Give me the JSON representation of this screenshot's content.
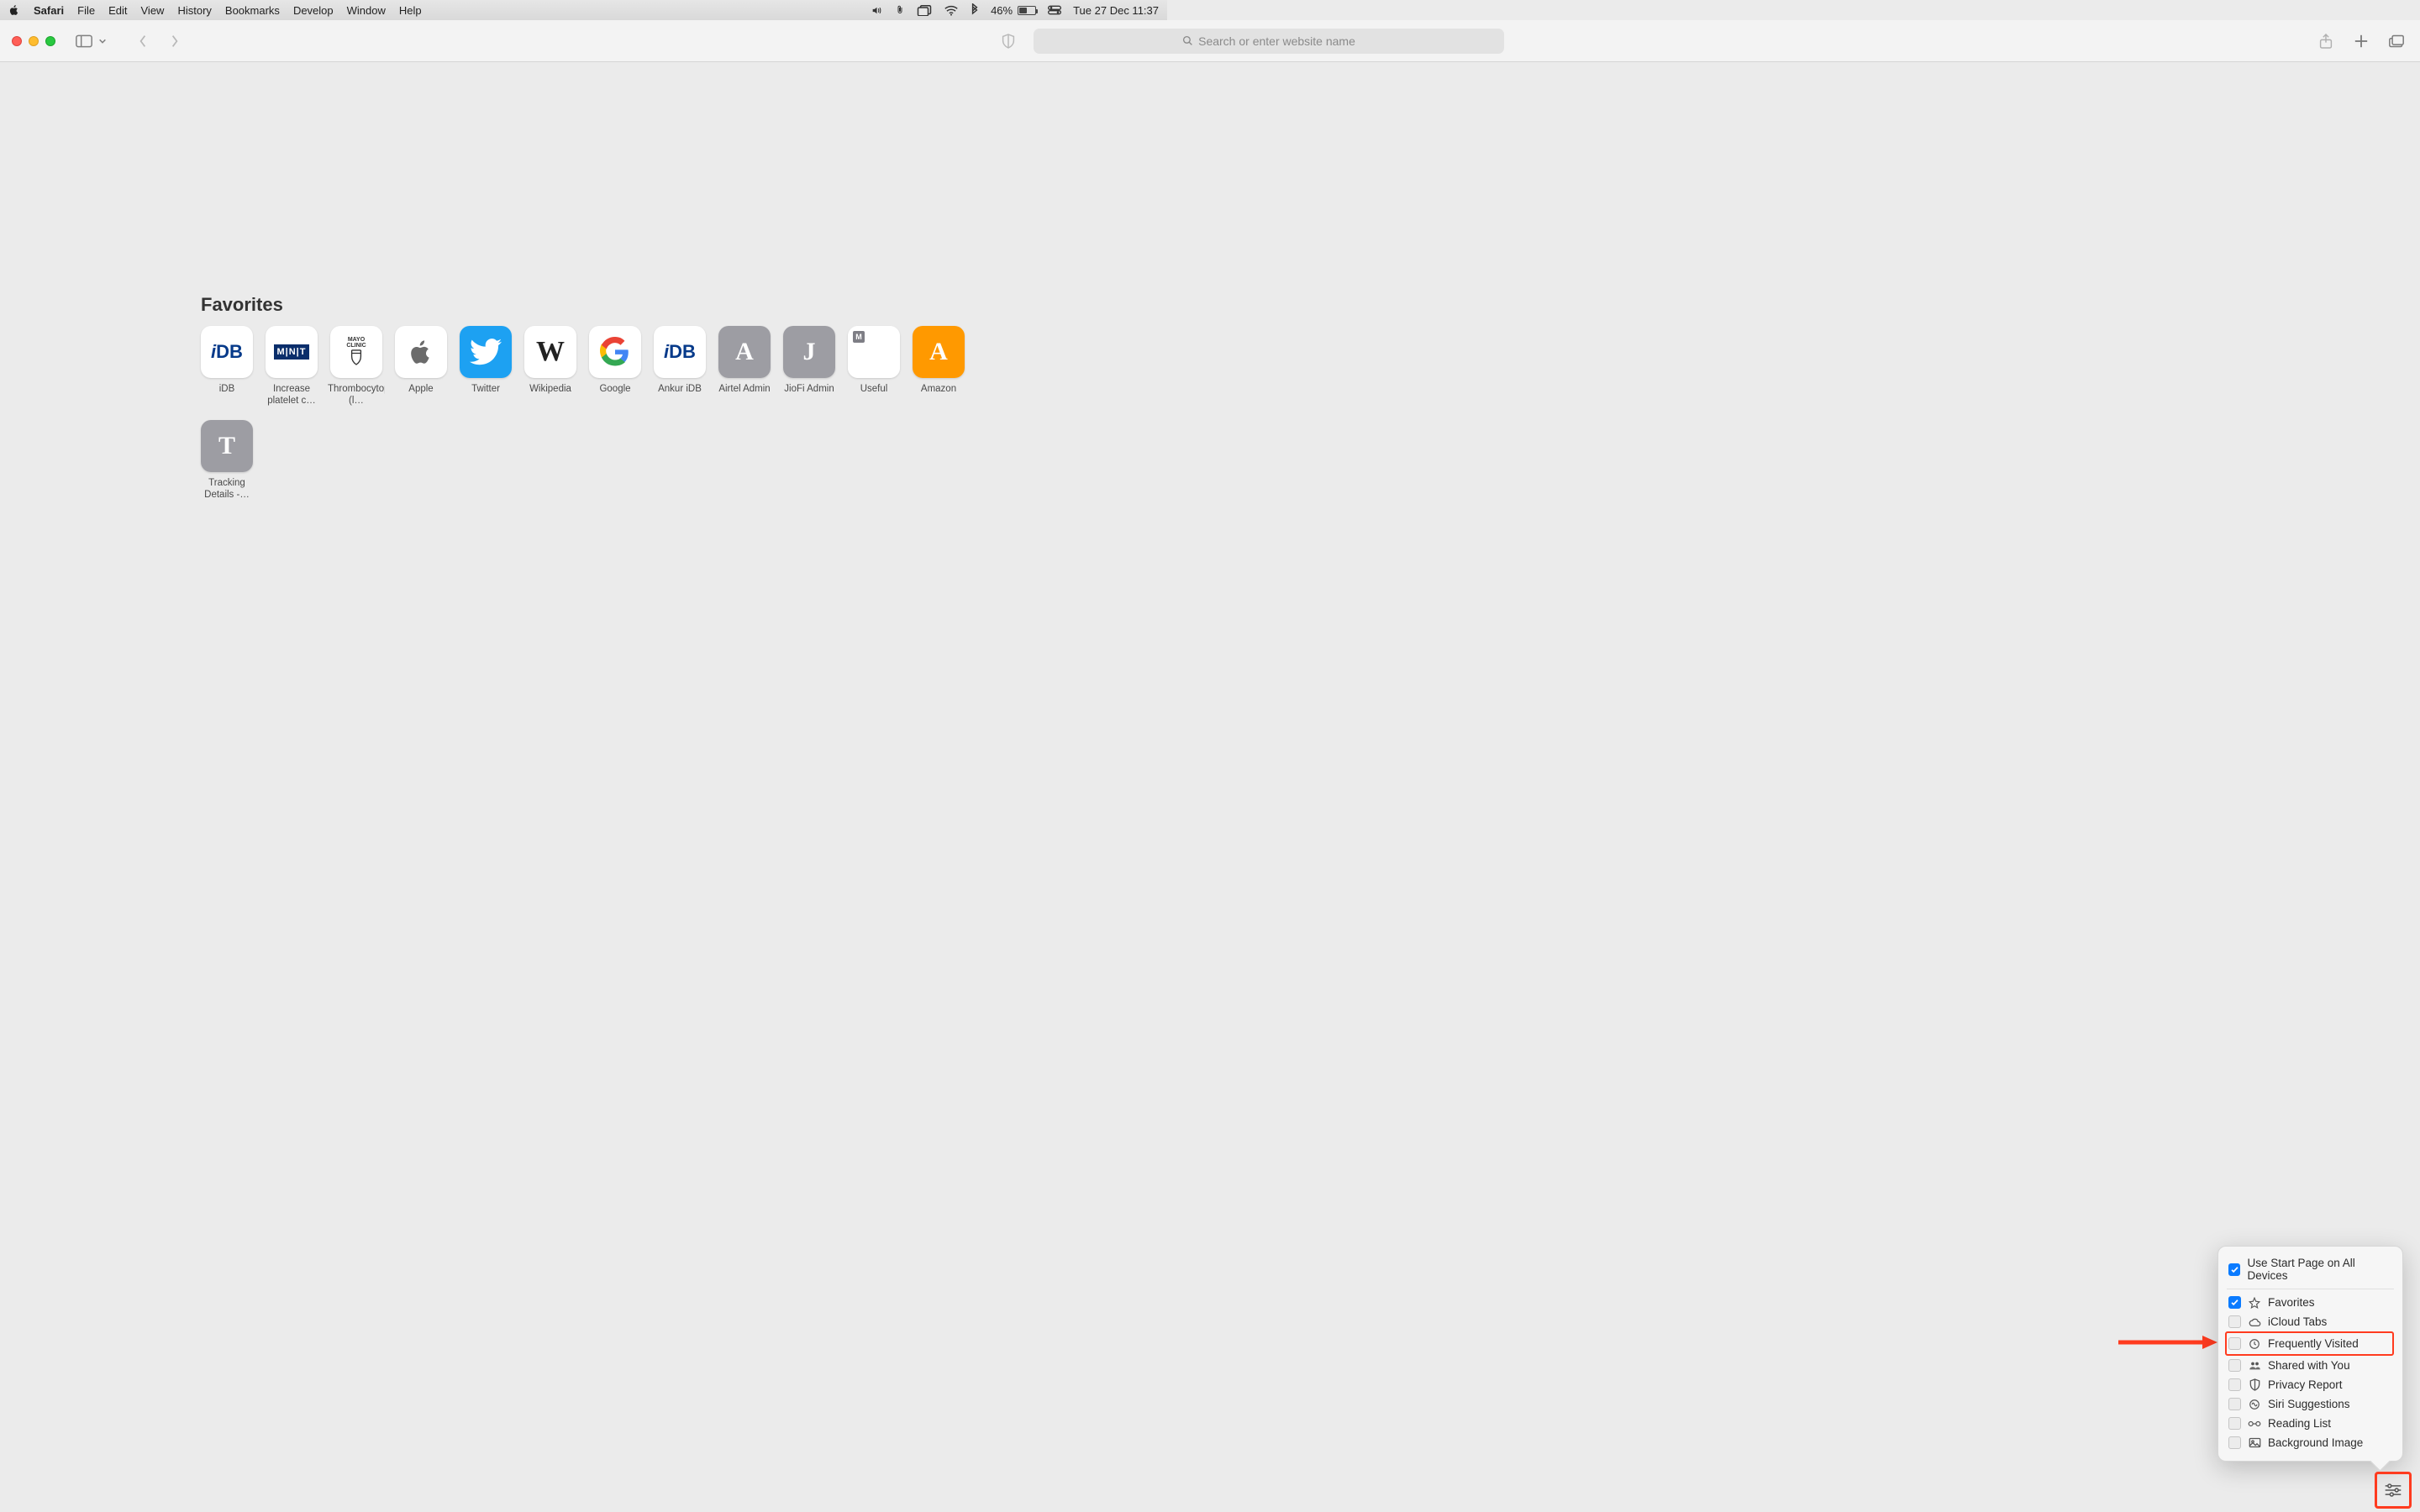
{
  "menubar": {
    "app": "Safari",
    "items": [
      "File",
      "Edit",
      "View",
      "History",
      "Bookmarks",
      "Develop",
      "Window",
      "Help"
    ],
    "battery_pct": "46%",
    "clock": "Tue 27 Dec  11:37"
  },
  "toolbar": {
    "search_placeholder": "Search or enter website name"
  },
  "favorites": {
    "title": "Favorites",
    "items": [
      {
        "label": "iDB",
        "tile": "idb"
      },
      {
        "label": "Increase platelet c…",
        "tile": "mnt"
      },
      {
        "label": "Thrombocytopenia (l…",
        "tile": "mayo"
      },
      {
        "label": "Apple",
        "tile": "apple"
      },
      {
        "label": "Twitter",
        "tile": "twitter"
      },
      {
        "label": "Wikipedia",
        "tile": "wiki"
      },
      {
        "label": "Google",
        "tile": "google"
      },
      {
        "label": "Ankur iDB",
        "tile": "idb"
      },
      {
        "label": "Airtel Admin",
        "tile": "letter",
        "letter": "A",
        "bg": "#9d9da3"
      },
      {
        "label": "JioFi Admin",
        "tile": "letter",
        "letter": "J",
        "bg": "#9d9da3"
      },
      {
        "label": "Useful",
        "tile": "folder"
      },
      {
        "label": "Amazon",
        "tile": "letter",
        "letter": "A",
        "bg": "#ff9900"
      },
      {
        "label": "Tracking Details -…",
        "tile": "letter",
        "letter": "T",
        "bg": "#9d9da3"
      }
    ]
  },
  "popover": {
    "header": "Use Start Page on All Devices",
    "rows": [
      {
        "label": "Favorites",
        "checked": true,
        "icon": "star"
      },
      {
        "label": "iCloud Tabs",
        "checked": false,
        "icon": "cloud"
      },
      {
        "label": "Frequently Visited",
        "checked": false,
        "icon": "clock",
        "highlight": true
      },
      {
        "label": "Shared with You",
        "checked": false,
        "icon": "people"
      },
      {
        "label": "Privacy Report",
        "checked": false,
        "icon": "shield"
      },
      {
        "label": "Siri Suggestions",
        "checked": false,
        "icon": "siri"
      },
      {
        "label": "Reading List",
        "checked": false,
        "icon": "glasses"
      },
      {
        "label": "Background Image",
        "checked": false,
        "icon": "image"
      }
    ]
  }
}
